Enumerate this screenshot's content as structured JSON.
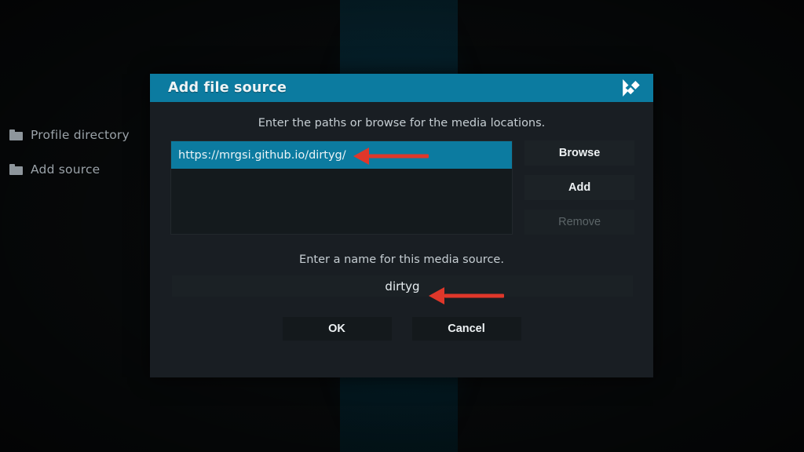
{
  "theme": {
    "accent": "#0c7ba0",
    "dialog_bg": "#191e23",
    "listbox_bg": "#141a1d",
    "button_bg": "#1c2226",
    "annotation_red": "#e0372a",
    "text_primary": "#eef2f4",
    "text_muted": "#c6ced3",
    "text_disabled": "#5c6568",
    "background_band": "#06232e"
  },
  "sidebar": {
    "items": [
      {
        "label": "Profile directory",
        "icon": "folder-icon"
      },
      {
        "label": "Add source",
        "icon": "folder-icon"
      }
    ]
  },
  "dialog": {
    "title": "Add file source",
    "logo_icon": "kodi-logo-icon",
    "paths_hint": "Enter the paths or browse for the media locations.",
    "paths": [
      {
        "value": "https://mrgsi.github.io/dirtyg/",
        "selected": true
      }
    ],
    "side_buttons": [
      {
        "label": "Browse",
        "enabled": true
      },
      {
        "label": "Add",
        "enabled": true
      },
      {
        "label": "Remove",
        "enabled": false
      }
    ],
    "name_hint": "Enter a name for this media source.",
    "name_field": {
      "value": "dirtyg",
      "placeholder": "Enter a name"
    },
    "bottom_buttons": [
      {
        "label": "OK"
      },
      {
        "label": "Cancel"
      }
    ]
  },
  "annotations": [
    {
      "name": "arrow-to-path-field",
      "direction": "left",
      "color": "#e0372a"
    },
    {
      "name": "arrow-to-name-field",
      "direction": "left",
      "color": "#e0372a"
    }
  ]
}
